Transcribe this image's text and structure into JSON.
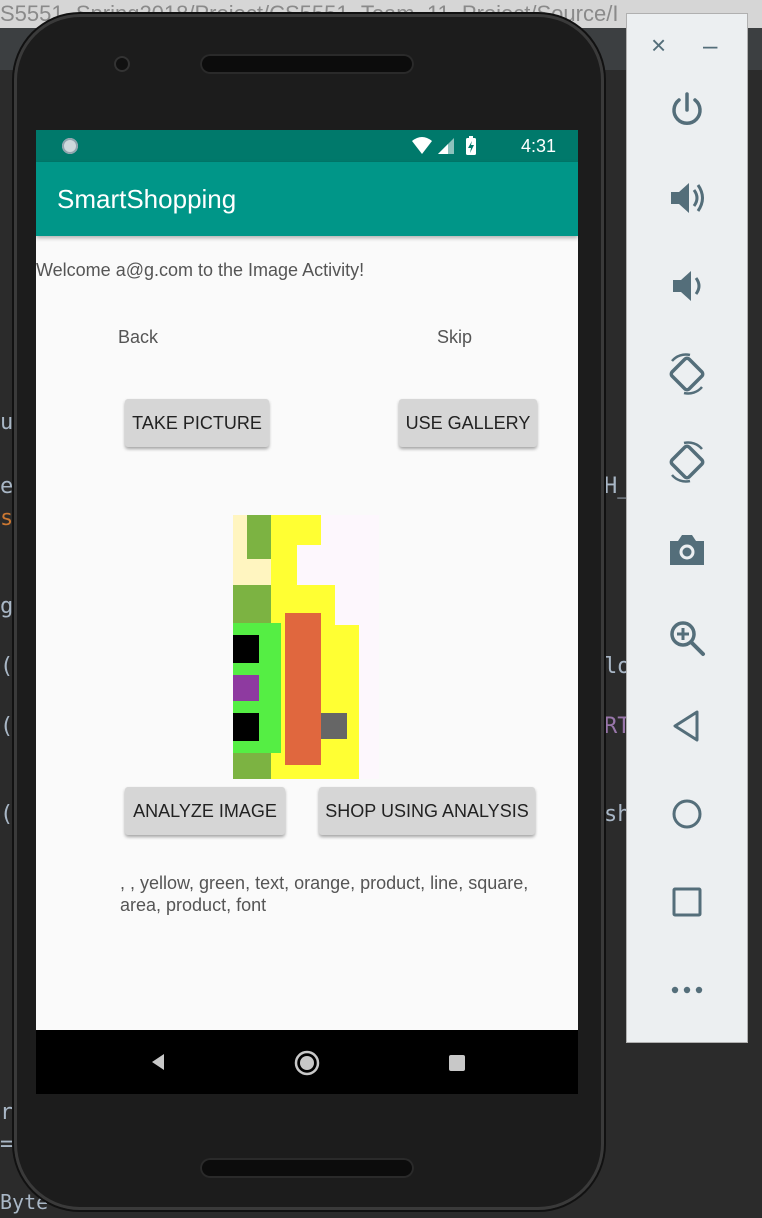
{
  "ide": {
    "title_path": "S5551_Spring2018/Project/CS5551_Team_11_Project/Source/I",
    "bottom_fragment": "Byte"
  },
  "status_bar": {
    "time": "4:31"
  },
  "app": {
    "title": "SmartShopping"
  },
  "content": {
    "welcome_text": "Welcome a@g.com to the Image Activity!",
    "back_label": "Back",
    "skip_label": "Skip",
    "take_picture_label": "Take Picture",
    "use_gallery_label": "Use Gallery",
    "analyze_image_label": "Analyze Image",
    "shop_using_analysis_label": "Shop Using Analysis",
    "analysis_result": ", , yellow, green, text, orange, product, line, square, area, product, font"
  },
  "nav_bar": {
    "back_icon": "back-triangle-icon",
    "home_icon": "home-circle-icon",
    "recents_icon": "recents-square-icon"
  },
  "emulator_panel": {
    "close_glyph": "×",
    "minimize_glyph": "–",
    "buttons": [
      "power-icon",
      "volume-up-icon",
      "volume-down-icon",
      "rotate-left-icon",
      "rotate-right-icon",
      "screenshot-camera-icon",
      "zoom-icon",
      "back-icon",
      "home-icon",
      "overview-icon",
      "more-icon"
    ]
  },
  "colors": {
    "primary": "#009688",
    "primary_dark": "#00796b",
    "button_bg": "#d6d6d6"
  }
}
